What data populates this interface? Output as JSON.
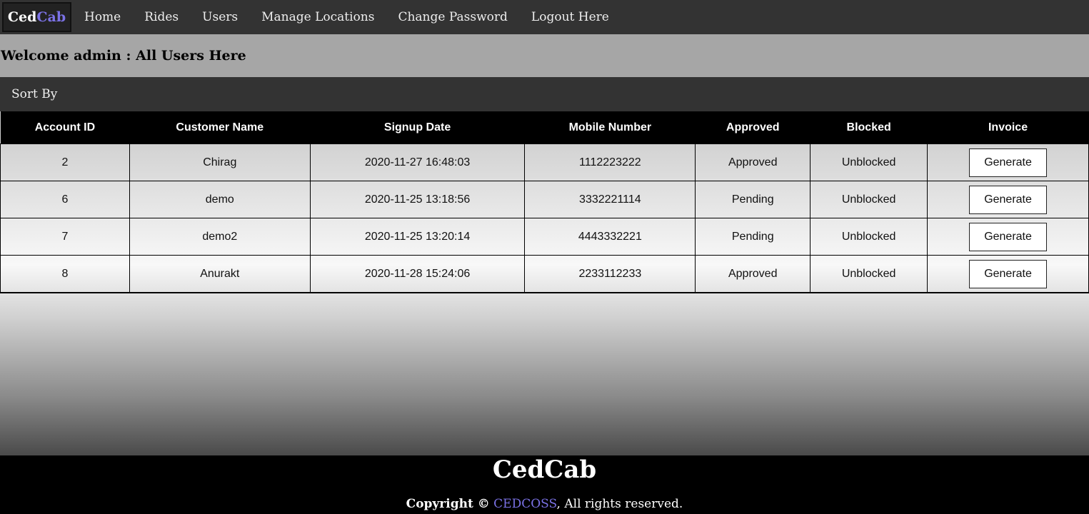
{
  "nav": {
    "brand_part1": "Ced",
    "brand_part2": "Cab",
    "links": [
      "Home",
      "Rides",
      "Users",
      "Manage Locations",
      "Change Password",
      "Logout Here"
    ]
  },
  "welcome": {
    "title": "Welcome admin : All Users Here"
  },
  "sort": {
    "label": "Sort By"
  },
  "table": {
    "headers": [
      "Account ID",
      "Customer Name",
      "Signup Date",
      "Mobile Number",
      "Approved",
      "Blocked",
      "Invoice"
    ],
    "rows": [
      {
        "id": "2",
        "name": "Chirag",
        "date": "2020-11-27 16:48:03",
        "mobile": "1112223222",
        "approved": "Approved",
        "blocked": "Unblocked",
        "invoice": "Generate"
      },
      {
        "id": "6",
        "name": "demo",
        "date": "2020-11-25 13:18:56",
        "mobile": "3332221114",
        "approved": "Pending",
        "blocked": "Unblocked",
        "invoice": "Generate"
      },
      {
        "id": "7",
        "name": "demo2",
        "date": "2020-11-25 13:20:14",
        "mobile": "4443332221",
        "approved": "Pending",
        "blocked": "Unblocked",
        "invoice": "Generate"
      },
      {
        "id": "8",
        "name": "Anurakt",
        "date": "2020-11-28 15:24:06",
        "mobile": "2233112233",
        "approved": "Approved",
        "blocked": "Unblocked",
        "invoice": "Generate"
      }
    ]
  },
  "footer": {
    "title": "CedCab",
    "copyright_lead": "Copyright ©",
    "company": "CEDCOSS",
    "rights": ", All rights reserved."
  },
  "colors": {
    "accent": "#7b72e6",
    "navbar": "#333333",
    "welcome_bg": "#a6a6a6"
  }
}
